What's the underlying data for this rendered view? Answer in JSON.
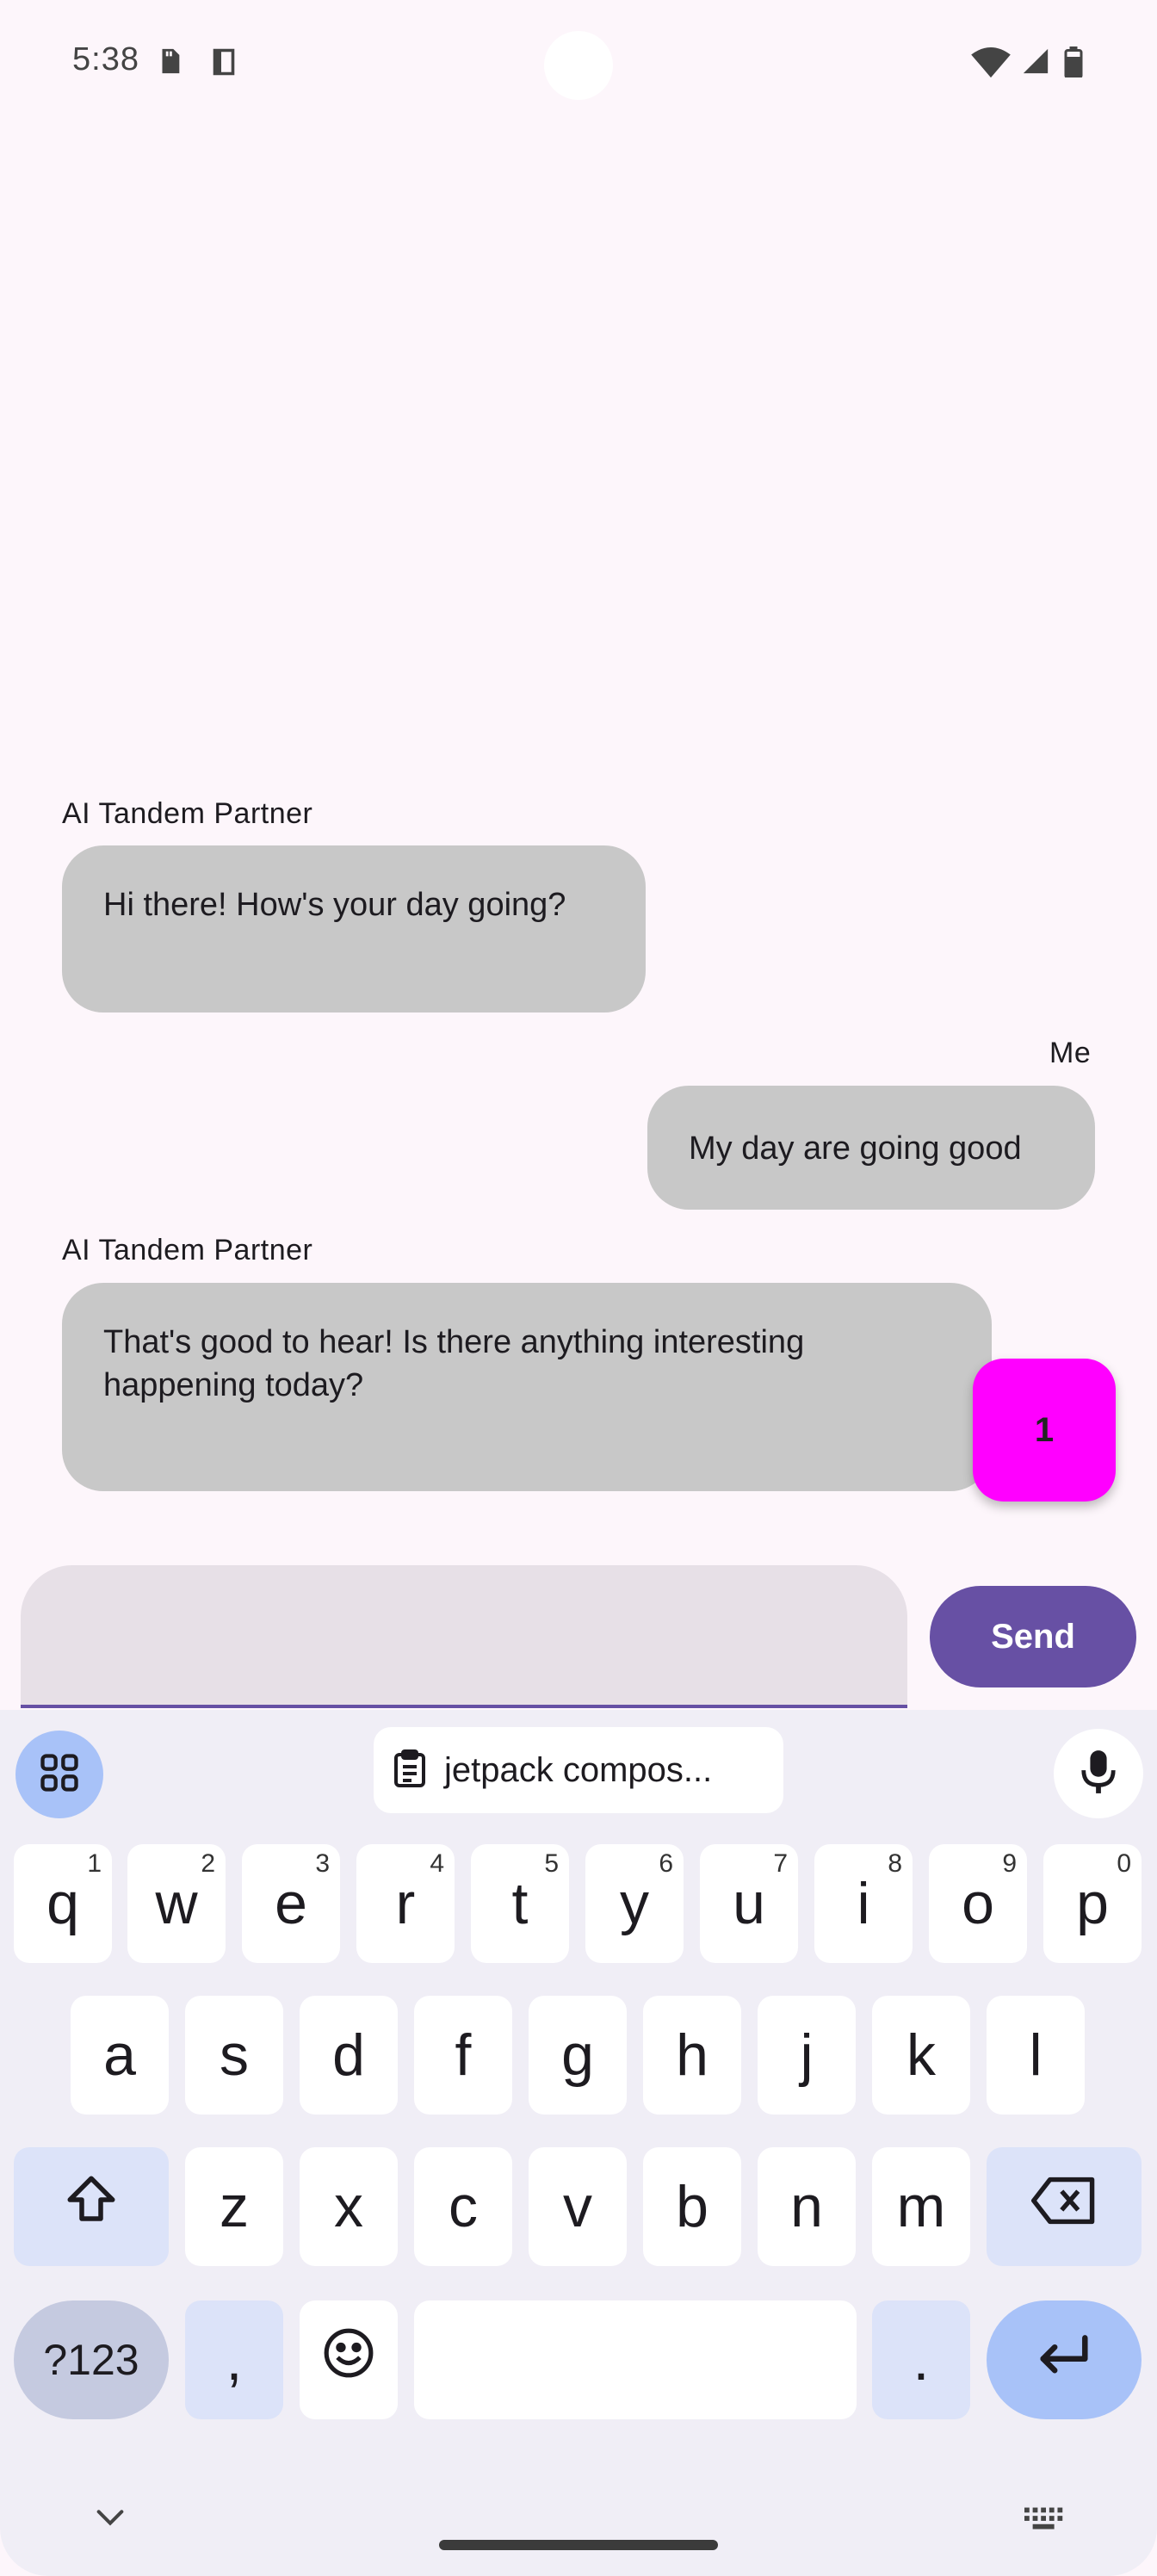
{
  "status_bar": {
    "time": "5:38",
    "icons": [
      "sd-card-icon",
      "screenshot-icon",
      "wifi-icon",
      "signal-icon",
      "battery-icon"
    ]
  },
  "messages": [
    {
      "sender": "AI Tandem Partner",
      "text": "Hi there! How's your day going?"
    },
    {
      "sender": "Me",
      "text": "My day are going good"
    },
    {
      "sender": "AI Tandem Partner",
      "text_line1": "That's good to hear!  Is there anything interesting",
      "text_line2": "happening today?"
    }
  ],
  "fab": {
    "label": "1",
    "color": "#ff00ff"
  },
  "input": {
    "value": "",
    "placeholder": ""
  },
  "send_button": {
    "label": "Send",
    "color": "#6750a4"
  },
  "keyboard": {
    "clipboard_suggestion": "jetpack compos...",
    "row1": [
      {
        "k": "q",
        "h": "1"
      },
      {
        "k": "w",
        "h": "2"
      },
      {
        "k": "e",
        "h": "3"
      },
      {
        "k": "r",
        "h": "4"
      },
      {
        "k": "t",
        "h": "5"
      },
      {
        "k": "y",
        "h": "6"
      },
      {
        "k": "u",
        "h": "7"
      },
      {
        "k": "i",
        "h": "8"
      },
      {
        "k": "o",
        "h": "9"
      },
      {
        "k": "p",
        "h": "0"
      }
    ],
    "row2": [
      "a",
      "s",
      "d",
      "f",
      "g",
      "h",
      "j",
      "k",
      "l"
    ],
    "row3": [
      "z",
      "x",
      "c",
      "v",
      "b",
      "n",
      "m"
    ],
    "symbols_key": "?123",
    "comma_key": ",",
    "period_key": "."
  }
}
